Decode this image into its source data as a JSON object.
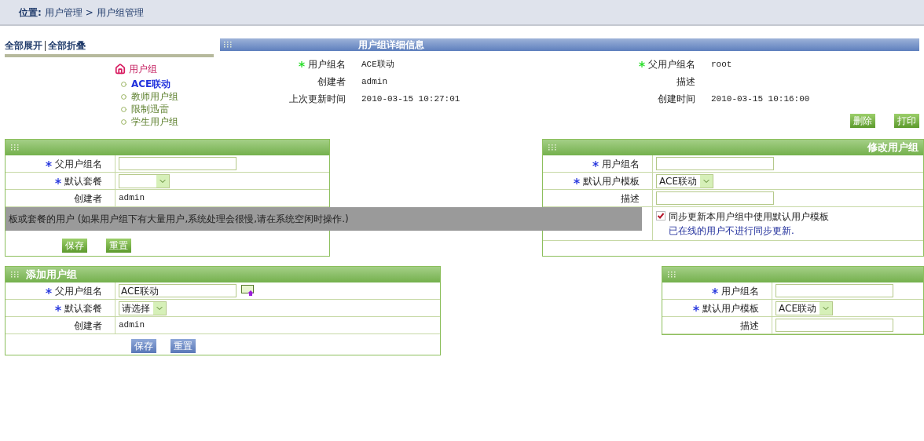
{
  "breadcrumb": {
    "label": "位置:",
    "separator": ">",
    "path": [
      "用户管理",
      "用户组管理"
    ]
  },
  "tree_toolbar": [
    "全部展开",
    "全部折叠"
  ],
  "tree": {
    "label": "用户组",
    "children": [
      {
        "label": "ACE联动",
        "selected": true
      },
      {
        "label": "教师用户组",
        "selected": false
      },
      {
        "label": "限制迅雷",
        "selected": false
      },
      {
        "label": "学生用户组",
        "selected": false
      }
    ]
  },
  "detail": {
    "title": "用户组详细信息",
    "fields": [
      {
        "label": "用户组名",
        "required": true,
        "value": "ACE联动"
      },
      {
        "label": "父用户组名",
        "required": true,
        "value": "root"
      },
      {
        "label": "创建者",
        "required": false,
        "value": "admin"
      },
      {
        "label": "描述",
        "required": false
      },
      {
        "label": "上次更新时间",
        "required": false,
        "value": "2010-03-15 10:27:01"
      },
      {
        "label": "创建时间",
        "required": false,
        "value": "2010-03-15 10:16:00"
      }
    ],
    "buttons": [
      "删除",
      "打印"
    ]
  },
  "edit_panel": {
    "fields": [
      {
        "kind": "text",
        "label": "父用户组名",
        "required": true
      },
      {
        "kind": "select",
        "label": "默认套餐",
        "required": true
      },
      {
        "kind": "static",
        "label": "创建者",
        "required": false,
        "value": "admin"
      }
    ],
    "note": "板或套餐的用户 (如果用户组下有大量用户,系统处理会很慢,请在系统空闲时操作.)",
    "buttons": [
      "保存",
      "重置"
    ]
  },
  "modify_panel": {
    "title": "修改用户组",
    "fields": [
      {
        "kind": "text",
        "label": "用户组名",
        "required": true
      },
      {
        "kind": "select",
        "label": "默认用户模板",
        "required": true,
        "value": "ACE联动"
      },
      {
        "kind": "text",
        "label": "描述",
        "required": false
      }
    ],
    "sync": {
      "checked": true,
      "label": "同步更新本用户组中使用默认用户模板",
      "hint": "已在线的用户不进行同步更新."
    }
  },
  "add_panel": {
    "title": "添加用户组",
    "fields": [
      {
        "kind": "picker",
        "label": "父用户组名",
        "required": true,
        "value": "ACE联动"
      },
      {
        "kind": "select",
        "label": "默认套餐",
        "required": true,
        "value": "请选择"
      },
      {
        "kind": "static",
        "label": "创建者",
        "required": false,
        "value": "admin"
      }
    ],
    "buttons": [
      "保存",
      "重置"
    ]
  },
  "add_panel_2": {
    "fields": [
      {
        "kind": "text",
        "label": "用户组名",
        "required": true
      },
      {
        "kind": "select",
        "label": "默认用户模板",
        "required": true,
        "value": "ACE联动"
      },
      {
        "kind": "text",
        "label": "描述",
        "required": false
      }
    ]
  }
}
